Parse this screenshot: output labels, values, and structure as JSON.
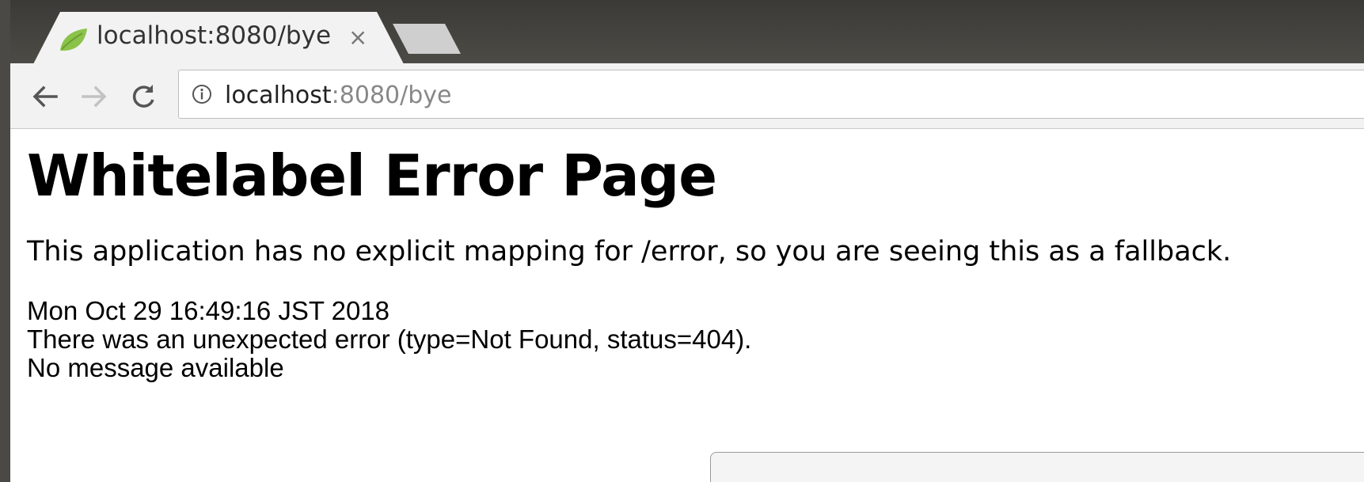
{
  "browser": {
    "tab": {
      "title": "localhost:8080/bye",
      "close_glyph": "×",
      "favicon": "spring-leaf-icon"
    },
    "address_bar": {
      "host": "localhost",
      "rest": ":8080/bye",
      "security_icon": "info-icon"
    },
    "nav": {
      "back_icon": "arrow-left-icon",
      "forward_icon": "arrow-right-icon",
      "reload_icon": "reload-icon"
    }
  },
  "page": {
    "heading": "Whitelabel Error Page",
    "message": "This application has no explicit mapping for /error, so you are seeing this as a fallback.",
    "timestamp": "Mon Oct 29 16:49:16 JST 2018",
    "error": "There was an unexpected error (type=Not Found, status=404).",
    "detail": "No message available"
  },
  "colors": {
    "tabstrip": "#3b3a36",
    "toolbar": "#f2f2f2",
    "favicon": "#8bc34a"
  }
}
